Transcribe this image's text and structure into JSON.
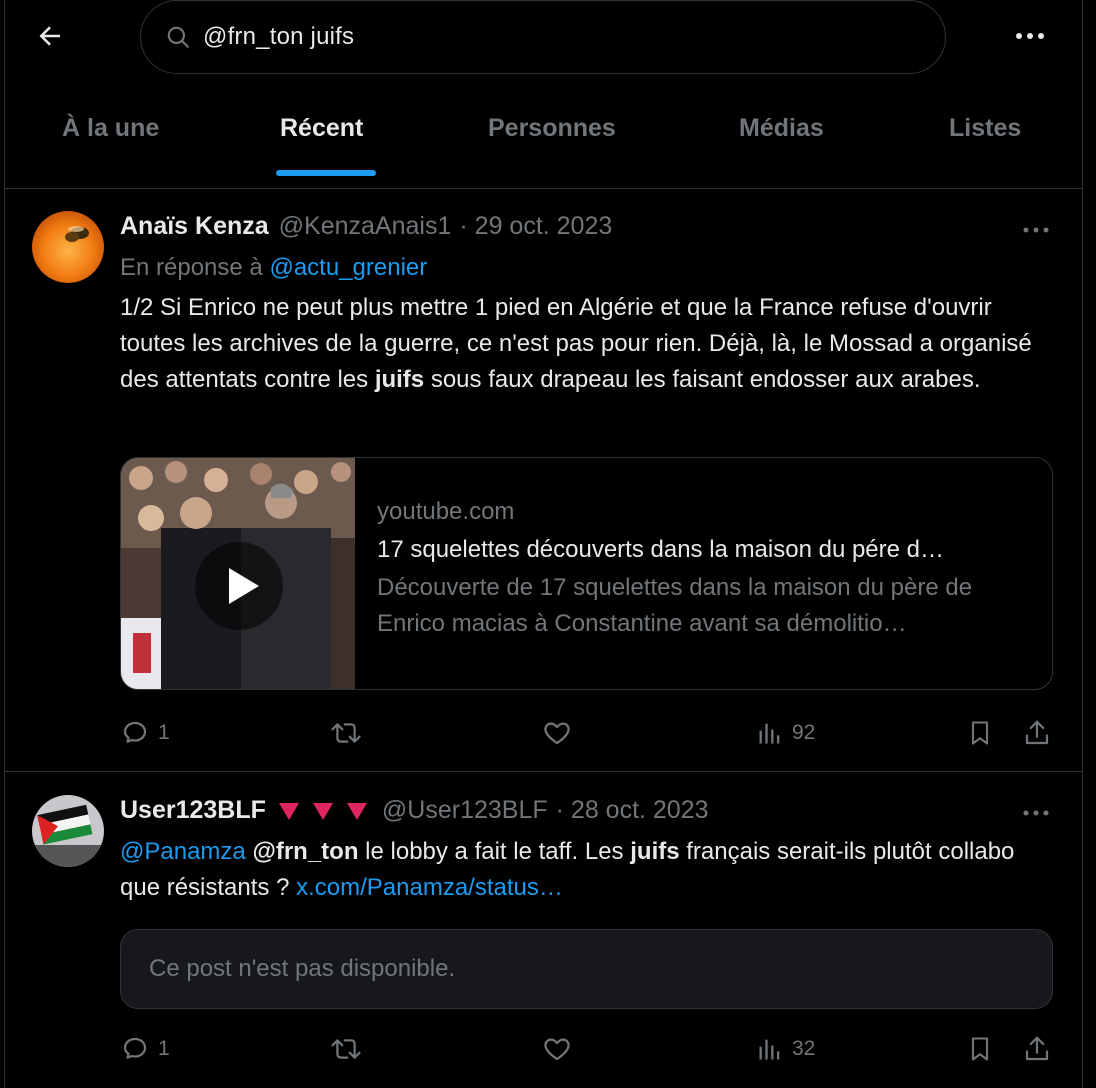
{
  "search": {
    "query": "@frn_ton juifs"
  },
  "tabs": [
    {
      "label": "À la une"
    },
    {
      "label": "Récent"
    },
    {
      "label": "Personnes"
    },
    {
      "label": "Médias"
    },
    {
      "label": "Listes"
    }
  ],
  "active_tab": "Récent",
  "colors": {
    "accent": "#1d9bf0",
    "background": "#000000",
    "muted": "#71767b",
    "text": "#e7e9ea",
    "flag_red": "#e0245e"
  },
  "tweets": [
    {
      "name": "Anaïs Kenza",
      "handle": "@KenzaAnais1",
      "date": "· 29 oct. 2023",
      "reply_prefix": "En réponse à",
      "reply_mention": "@actu_grenier",
      "text_a": "1/2 Si Enrico ne peut plus mettre 1 pied en Algérie et que la France refuse d'ouvrir toutes les archives de la guerre, ce n'est pas pour rien. Déjà, là, le Mossad a organisé des attentats contre les ",
      "text_bold": "juifs",
      "text_b": " sous faux drapeau les faisant endosser aux arabes.",
      "card": {
        "domain": "youtube.com",
        "title": "17 squelettes découverts dans la maison du pére d…",
        "desc": "Découverte de 17 squelettes dans la maison du père de Enrico macias à Constantine avant sa démolitio…"
      },
      "replies": "1",
      "views": "92"
    },
    {
      "name": "User123BLF",
      "name_badges": "🔻🔻🔻",
      "handle": "@User123BLF",
      "date": "· 28 oct. 2023",
      "m1": "@Panamza",
      "m2": "@frn_ton",
      "t1": " le lobby a fait le taff. Les ",
      "bold": "juifs",
      "t2": " français serait-ils plutôt collabo que résistants ? ",
      "link": "x.com/Panamza/status…",
      "unavailable": "Ce post n'est pas disponible.",
      "replies": "1",
      "views": "32"
    }
  ]
}
